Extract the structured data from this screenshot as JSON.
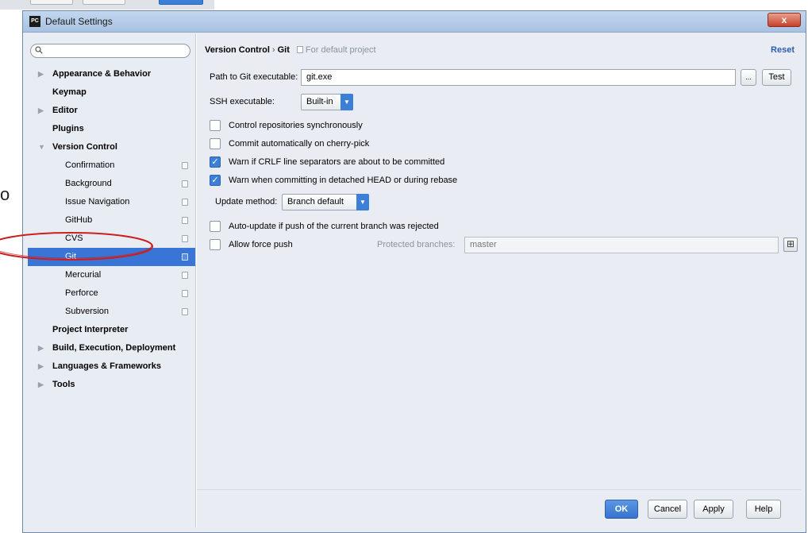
{
  "window": {
    "title": "Default Settings",
    "app_icon": "PC",
    "close": "x"
  },
  "stray_text": "o",
  "sidebar": {
    "search": {
      "value": "",
      "placeholder": ""
    },
    "items": [
      {
        "label": "Appearance & Behavior",
        "level": 0,
        "expandable": true
      },
      {
        "label": "Keymap",
        "level": 0,
        "expandable": false
      },
      {
        "label": "Editor",
        "level": 0,
        "expandable": true
      },
      {
        "label": "Plugins",
        "level": 0,
        "expandable": false
      },
      {
        "label": "Version Control",
        "level": 0,
        "expanded": true
      },
      {
        "label": "Confirmation",
        "level": 1
      },
      {
        "label": "Background",
        "level": 1
      },
      {
        "label": "Issue Navigation",
        "level": 1
      },
      {
        "label": "GitHub",
        "level": 1
      },
      {
        "label": "CVS",
        "level": 1
      },
      {
        "label": "Git",
        "level": 1,
        "selected": true
      },
      {
        "label": "Mercurial",
        "level": 1
      },
      {
        "label": "Perforce",
        "level": 1
      },
      {
        "label": "Subversion",
        "level": 1
      },
      {
        "label": "Project Interpreter",
        "level": 0,
        "expandable": false
      },
      {
        "label": "Build, Execution, Deployment",
        "level": 0,
        "expandable": true
      },
      {
        "label": "Languages & Frameworks",
        "level": 0,
        "expandable": true
      },
      {
        "label": "Tools",
        "level": 0,
        "expandable": true
      }
    ]
  },
  "content": {
    "breadcrumb": {
      "parent": "Version Control",
      "separator": "›",
      "current": "Git",
      "note": "For default project"
    },
    "reset": "Reset",
    "path_label": "Path to Git executable:",
    "path_value": "git.exe",
    "browse": "...",
    "test": "Test",
    "ssh_label": "SSH executable:",
    "ssh_value": "Built-in",
    "checkboxes": {
      "sync": {
        "label": "Control repositories synchronously",
        "checked": false
      },
      "cherry": {
        "label": "Commit automatically on cherry-pick",
        "checked": false
      },
      "crlf": {
        "label": "Warn if CRLF line separators are about to be committed",
        "checked": true
      },
      "detached": {
        "label": "Warn when committing in detached HEAD or during rebase",
        "checked": true
      },
      "autoupdate": {
        "label": "Auto-update if push of the current branch was rejected",
        "checked": false
      },
      "force": {
        "label": "Allow force push",
        "checked": false
      }
    },
    "update_label": "Update method:",
    "update_value": "Branch default",
    "protected_label": "Protected branches:",
    "protected_value": "master"
  },
  "footer": {
    "ok": "OK",
    "cancel": "Cancel",
    "apply": "Apply",
    "help": "Help"
  },
  "colors": {
    "selection": "#3875d7",
    "accent": "#3b7fd6",
    "link": "#2a5db0",
    "annotation": "#cc1f1f"
  }
}
